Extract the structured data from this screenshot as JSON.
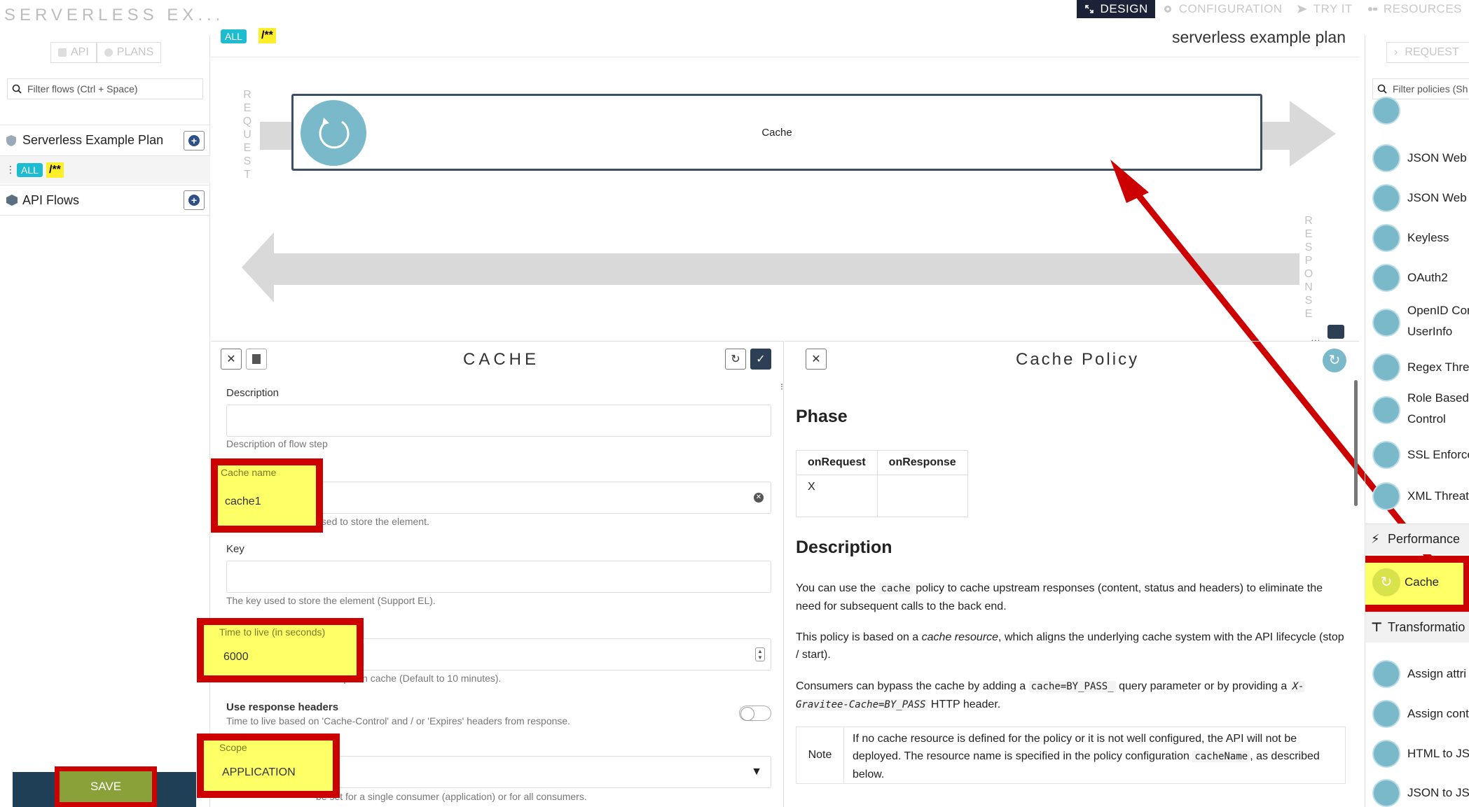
{
  "app": {
    "title": "SERVERLESS EX..."
  },
  "top_tabs": [
    {
      "label": "DESIGN",
      "icon": "design-icon",
      "active": true
    },
    {
      "label": "CONFIGURATION",
      "icon": "gear-icon"
    },
    {
      "label": "TRY IT",
      "icon": "send-icon"
    },
    {
      "label": "RESOURCES",
      "icon": "resources-icon"
    }
  ],
  "left_sidebar": {
    "api_label": "API",
    "plans_label": "PLANS",
    "filter_placeholder": "Filter flows (Ctrl + Space)",
    "plan_name": "Serverless Example Plan",
    "flow_method": "ALL",
    "flow_path": "/**",
    "api_flows_label": "API Flows",
    "save_label": "SAVE"
  },
  "flow": {
    "method": "ALL",
    "path": "/**",
    "plan_title": "serverless example plan",
    "request_label": "REQUEST",
    "response_label": "RESPONSE",
    "step_name": "Cache"
  },
  "form": {
    "title": "CACHE",
    "description_label": "Description",
    "description_help": "Description of flow step",
    "cache_name_label": "Cache name",
    "cache_name_value": "cache1",
    "cache_name_help_tail": "used to store the element.",
    "key_label": "Key",
    "key_help": "The key used to store the element (Support EL).",
    "ttl_label": "Time to live (in seconds)",
    "ttl_value": "6000",
    "ttl_help": "Time to live of the element put in cache (Default to 10 minutes).",
    "use_headers_label": "Use response headers",
    "use_headers_help": "Time to live based on 'Cache-Control' and / or 'Expires' headers from response.",
    "use_headers_enabled": false,
    "scope_label": "Scope",
    "scope_value": "APPLICATION",
    "scope_help_tail": "be set for a single consumer (application) or for all consumers."
  },
  "doc": {
    "title": "Cache Policy",
    "phase_heading": "Phase",
    "phase_cols": [
      "onRequest",
      "onResponse"
    ],
    "phase_row": [
      "X",
      ""
    ],
    "description_heading": "Description",
    "p1_a": "You can use the",
    "p1_code": "cache",
    "p1_b": "policy to cache upstream responses (content, status and headers) to eliminate the need for subsequent calls to the back end.",
    "p2_a": "This policy is based on a",
    "p2_em": "cache resource",
    "p2_b": ", which aligns the underlying cache system with the API lifecycle (stop / start).",
    "p3_a": "Consumers can bypass the cache by adding a",
    "p3_code1": "cache=BY_PASS_",
    "p3_b": "query parameter or by providing a",
    "p3_code2": "X-Gravitee-Cache=BY_PASS",
    "p3_c": "HTTP header.",
    "note_label": "Note",
    "note_a": "If no cache resource is defined for the policy or it is not well configured, the API will not be deployed. The resource name is specified in the policy configuration",
    "note_code": "cacheName",
    "note_b": ", as described below."
  },
  "right_sidebar": {
    "request_label": "REQUEST",
    "filter_placeholder": "Filter policies (Sh",
    "policies_top": [
      "JSON Web S",
      "JSON Web T",
      "Keyless",
      "OAuth2",
      "OpenID Cor",
      "UserInfo",
      "Regex Threa",
      "Role Based",
      "Control",
      "SSL Enforce",
      "XML Threat"
    ],
    "performance_label": "Performance",
    "cache_label": "Cache",
    "transformation_label": "Transformatio",
    "policies_bottom": [
      "Assign attri",
      "Assign cont",
      "HTML to JS",
      "JSON to JSC"
    ]
  },
  "colors": {
    "accent": "#7ab9c9",
    "highlight": "#ffff66",
    "annotation": "#cc0000",
    "nav_active": "#1b2238"
  }
}
